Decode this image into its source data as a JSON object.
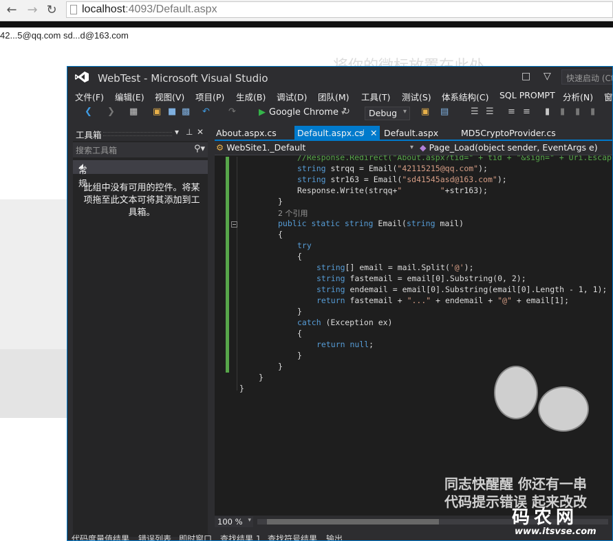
{
  "browser": {
    "url_host": "localhost",
    "url_path": ":4093/Default.aspx"
  },
  "page": {
    "output_text": "42...5@qq.com sd...d@163.com",
    "watermark_text": "将你的微标放置在此处"
  },
  "vs": {
    "title": "WebTest - Microsoft Visual Studio",
    "quick_launch_placeholder": "快速启动 (Ctr",
    "menu": [
      "文件(F)",
      "编辑(E)",
      "视图(V)",
      "项目(P)",
      "生成(B)",
      "调试(D)",
      "团队(M)",
      "工具(T)",
      "测试(S)",
      "体系结构(C)",
      "SQL PROMPT",
      "分析(N)",
      "窗"
    ],
    "toolbar": {
      "run_target": "Google Chrome",
      "configuration": "Debug"
    },
    "toolbox": {
      "title": "工具箱",
      "search_placeholder": "搜索工具箱",
      "group": "常规",
      "empty_message": "此组中没有可用的控件。将某项拖至此文本可将其添加到工具箱。"
    },
    "tabs": [
      {
        "label": "About.aspx.cs",
        "active": false
      },
      {
        "label": "Default.aspx.cs",
        "active": true
      },
      {
        "label": "Default.aspx",
        "active": false
      },
      {
        "label": "MD5CryptoProvider.cs",
        "active": false
      }
    ],
    "nav": {
      "class_combo": "WebSite1._Default",
      "member_combo": "Page_Load(object sender, EventArgs e)"
    },
    "code": {
      "l1_comment": "//Response.Redirect(\"About.aspx?tid=\" + tid + \"&sign=\" + Uri.Escap",
      "l2_kw": "string",
      "l2_a": " strqq = Email(",
      "l2_str": "\"42115215@qq.com\"",
      "l2_b": ");",
      "l3_kw": "string",
      "l3_a": " str163 = Email(",
      "l3_str": "\"sd41545asd@163.com\"",
      "l3_b": ");",
      "l4_a": "Response.Write(strqq+",
      "l4_str": "\"        \"",
      "l4_b": "+str163);",
      "l5": "}",
      "l6_ref": "2 个引用",
      "l7_kw": "public static string",
      "l7_a": " Email(",
      "l7_kw2": "string",
      "l7_b": " mail)",
      "l8": "{",
      "l9_kw": "try",
      "l10": "{",
      "l11_kw": "string",
      "l11_a": "[] email = mail.Split(",
      "l11_str": "'@'",
      "l11_b": ");",
      "l12_kw": "string",
      "l12_a": " fastemail = email[0].Substring(0, 2);",
      "l13_kw": "string",
      "l13_a": " endemail = email[0].Substring(email[0].Length - 1, 1);",
      "l14_kw": "return",
      "l14_a": " fastemail + ",
      "l14_str": "\"...\"",
      "l14_b": " + endemail + ",
      "l14_str2": "\"@\"",
      "l14_c": " + email[1];",
      "l15": "}",
      "l16_kw": "catch",
      "l16_a": " (Exception ex)",
      "l17": "{",
      "l18_kw": "return",
      "l18_kw2": " null",
      "l18_a": ";",
      "l19": "}",
      "l20": "}",
      "l21": "}",
      "l22": "}"
    },
    "meme": {
      "line1": "同志快醒醒 你还有一串",
      "line2": "代码提示错误 起来改改",
      "logo": "码农网",
      "url": "www.itsvse.com"
    },
    "zoom": "100 %",
    "bottom_tabs": [
      "代码度量值结果",
      "错误列表",
      "即时窗口",
      "查找结果 1",
      "查找符号结果",
      "输出"
    ]
  }
}
